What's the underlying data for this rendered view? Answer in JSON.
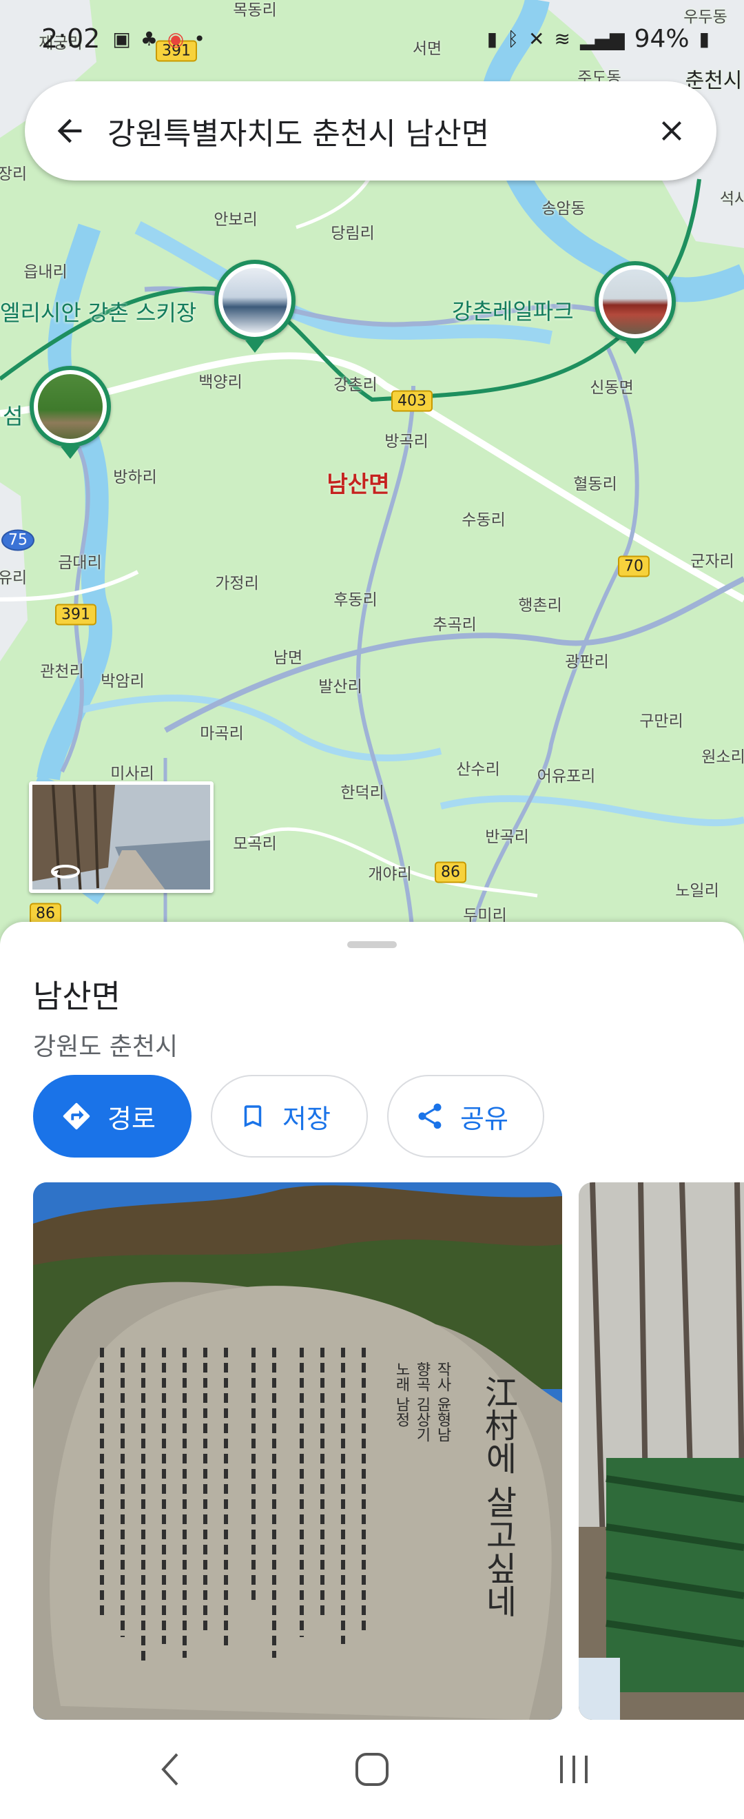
{
  "status_bar": {
    "time": "2:02",
    "battery": "94%",
    "left_icons": [
      "gallery-icon",
      "tools-icon",
      "browser-icon",
      "dot-icon"
    ],
    "right_icons": [
      "battery-saver-icon",
      "bluetooth-icon",
      "mute-icon",
      "wifi-icon",
      "signal-icon"
    ]
  },
  "search": {
    "query": "강원특별자치도 춘천시 남산면"
  },
  "map": {
    "region_label": "남산면",
    "poi": [
      {
        "name": "엘리시안 강촌 스키장",
        "icon": "ski-resort-thumbnail"
      },
      {
        "name": "강촌레일파크",
        "icon": "rail-park-thumbnail"
      },
      {
        "name": "섬",
        "icon": "island-thumbnail"
      }
    ],
    "places": [
      "목동리",
      "서면",
      "재궁리",
      "우두동",
      "주도동",
      "춘천시",
      "장리",
      "안보리",
      "당림리",
      "송암동",
      "읍내리",
      "백양리",
      "강촌리",
      "신동면",
      "방곡리",
      "방하리",
      "혈동리",
      "수동리",
      "금대리",
      "가정리",
      "후동리",
      "추곡리",
      "행촌리",
      "군자리",
      "유리",
      "관천리",
      "박암리",
      "남면",
      "발산리",
      "광판리",
      "구만리",
      "마곡리",
      "산수리",
      "어유포리",
      "원소리",
      "미사리",
      "한덕리",
      "모곡리",
      "반곡리",
      "개야리",
      "노일리",
      "두미리",
      "석사"
    ],
    "route_shields": [
      "391",
      "403",
      "75",
      "70",
      "391",
      "86",
      "86"
    ]
  },
  "place": {
    "title": "남산면",
    "subtitle": "강원도 춘천시"
  },
  "actions": {
    "directions": "경로",
    "save": "저장",
    "share": "공유"
  },
  "photos": {
    "main_caption": "",
    "stone_text": [
      "江村에 살고싶네",
      "작사 윤형남",
      "향곡 김상기",
      "노래 남정"
    ]
  },
  "colors": {
    "accent": "#1a73e8",
    "poi_green": "#137c5d",
    "region_red": "#c5221f",
    "map_bg": "#cdeec3",
    "road": "#9fb2d6"
  },
  "navbar": {
    "icons": [
      "back-nav-icon",
      "home-nav-icon",
      "recents-nav-icon"
    ]
  }
}
